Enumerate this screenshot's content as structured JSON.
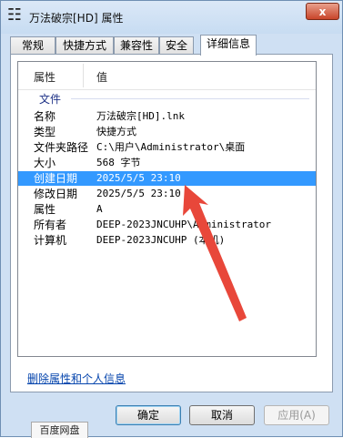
{
  "window": {
    "title": "万法破宗[HD] 属性",
    "app_icon": "paw-print-icon",
    "close_label": "x"
  },
  "tabs": [
    {
      "label": "常规",
      "active": false
    },
    {
      "label": "快捷方式",
      "active": false
    },
    {
      "label": "兼容性",
      "active": false
    },
    {
      "label": "安全",
      "active": false
    },
    {
      "label": "详细信息",
      "active": true
    }
  ],
  "details": {
    "col_property": "属性",
    "col_value": "值",
    "group": "文件",
    "rows": [
      {
        "key": "名称",
        "value": "万法破宗[HD].lnk",
        "selected": false
      },
      {
        "key": "类型",
        "value": "快捷方式",
        "selected": false
      },
      {
        "key": "文件夹路径",
        "value": "C:\\用户\\Administrator\\桌面",
        "selected": false
      },
      {
        "key": "大小",
        "value": "568 字节",
        "selected": false
      },
      {
        "key": "创建日期",
        "value": "2025/5/5 23:10",
        "selected": true
      },
      {
        "key": "修改日期",
        "value": "2025/5/5 23:10",
        "selected": false
      },
      {
        "key": "属性",
        "value": "A",
        "selected": false
      },
      {
        "key": "所有者",
        "value": "DEEP-2023JNCUHP\\Administrator",
        "selected": false
      },
      {
        "key": "计算机",
        "value": "DEEP-2023JNCUHP (本机)",
        "selected": false
      }
    ]
  },
  "annotation": {
    "color": "#e8473a"
  },
  "remove_link": "删除属性和个人信息",
  "buttons": {
    "ok": "确定",
    "cancel": "取消",
    "apply": "应用(A)"
  },
  "taskbar_tab": "百度网盘",
  "colors": {
    "selection": "#3399ff",
    "link": "#0645ad"
  }
}
